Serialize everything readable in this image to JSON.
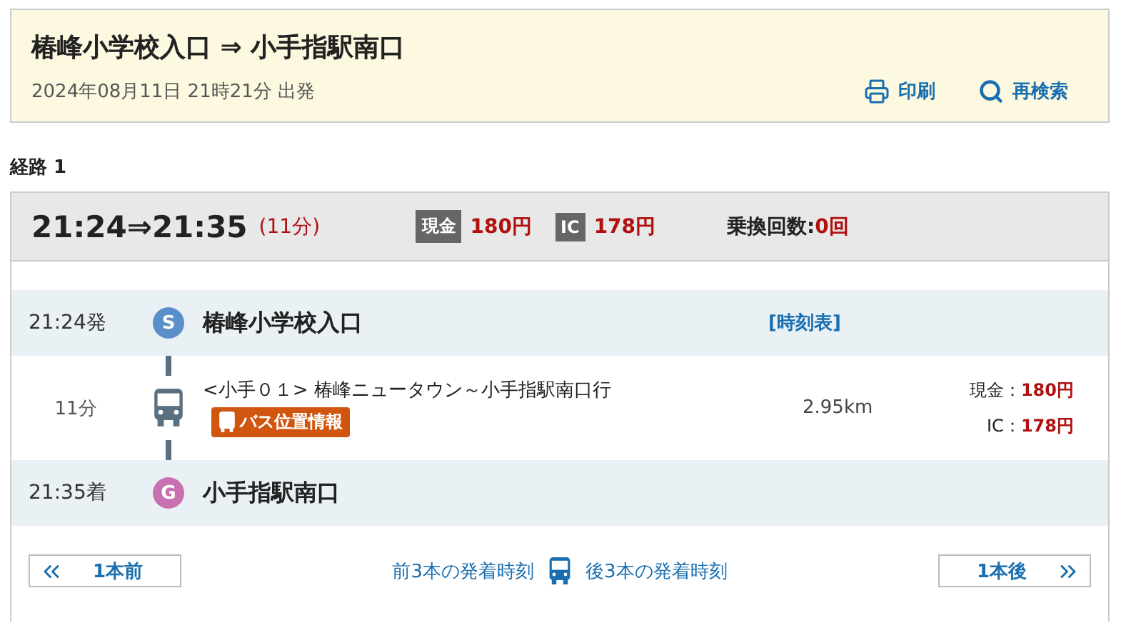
{
  "header": {
    "title": "椿峰小学校入口 ⇒ 小手指駅南口",
    "date": "2024年08月11日 21時21分 出発",
    "actions": [
      {
        "kind": "print",
        "label": "印刷"
      },
      {
        "kind": "search",
        "label": "再検索"
      }
    ]
  },
  "route": {
    "label": "経路 1",
    "times": "21:24⇒21:35",
    "duration": "(11分)",
    "fares": [
      {
        "tag": "現金",
        "price": "180円"
      },
      {
        "tag": "IC",
        "price": "178円"
      }
    ],
    "transfers_label": "乗換回数:",
    "transfers": "0回",
    "departure": {
      "time": "21:24発",
      "marker": "S",
      "kind": "start",
      "name": "椿峰小学校入口",
      "link": "[時刻表]"
    },
    "segment": {
      "duration": "11分",
      "line": "<小手０１> 椿峰ニュータウン～小手指駅南口行",
      "badge": "バス位置情報",
      "distance": "2.95km",
      "fares": [
        {
          "label": "現金：",
          "price": "180円"
        },
        {
          "label": "IC：",
          "price": "178円"
        }
      ]
    },
    "arrival": {
      "time": "21:35着",
      "marker": "G",
      "kind": "goal",
      "name": "小手指駅南口"
    },
    "footer": {
      "prev": "1本前",
      "prev_times": "前3本の発着時刻",
      "next_times": "後3本の発着時刻",
      "next": "1本後"
    }
  }
}
